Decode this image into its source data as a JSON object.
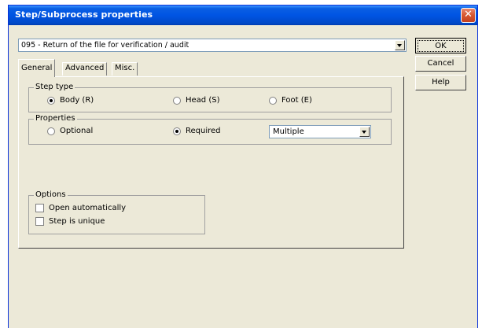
{
  "window": {
    "title": "Step/Subprocess properties"
  },
  "step_select": {
    "value": "095 - Return of the file for verification / audit"
  },
  "buttons": {
    "ok": "OK",
    "cancel": "Cancel",
    "help": "Help"
  },
  "tabs": [
    {
      "label": "General",
      "active": true
    },
    {
      "label": "Advanced",
      "active": false
    },
    {
      "label": "Misc.",
      "active": false
    }
  ],
  "step_type": {
    "label": "Step type",
    "options": [
      {
        "label": "Body (R)",
        "selected": true
      },
      {
        "label": "Head (S)",
        "selected": false
      },
      {
        "label": "Foot (E)",
        "selected": false
      }
    ]
  },
  "properties": {
    "label": "Properties",
    "options": [
      {
        "label": "Optional",
        "selected": false
      },
      {
        "label": "Required",
        "selected": true
      }
    ],
    "multiplicity": "Multiple"
  },
  "options": {
    "label": "Options",
    "items": [
      {
        "label": "Open automatically",
        "checked": false
      },
      {
        "label": "Step is unique",
        "checked": false
      }
    ]
  }
}
